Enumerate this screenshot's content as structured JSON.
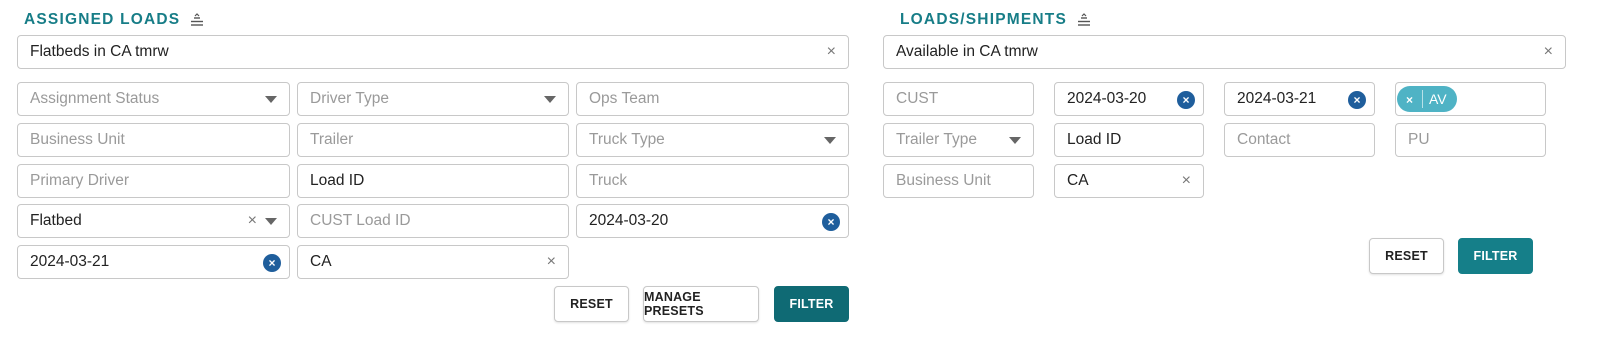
{
  "assigned_loads": {
    "title": "ASSIGNED LOADS",
    "search_value": "Flatbeds in CA tmrw",
    "fields": {
      "assignment_status": "Assignment Status",
      "driver_type": "Driver Type",
      "ops_team": "Ops Team",
      "business_unit": "Business Unit",
      "trailer": "Trailer",
      "truck_type": "Truck Type",
      "primary_driver": "Primary Driver",
      "load_id": "Load ID",
      "truck": "Truck",
      "trailer_type_value": "Flatbed",
      "cust_load_id": "CUST Load ID",
      "date_start": "2024-03-20",
      "date_end": "2024-03-21",
      "state_value": "CA"
    },
    "buttons": {
      "reset": "RESET",
      "manage_presets": "MANAGE PRESETS",
      "filter": "FILTER"
    }
  },
  "loads_shipments": {
    "title": "LOADS/SHIPMENTS",
    "search_value": "Available in CA tmrw",
    "fields": {
      "cust": "CUST",
      "date_start": "2024-03-20",
      "date_end": "2024-03-21",
      "status_chip": "AV",
      "trailer_type": "Trailer Type",
      "load_id": "Load ID",
      "contact": "Contact",
      "pu": "PU",
      "business_unit": "Business Unit",
      "state_value": "CA"
    },
    "buttons": {
      "reset": "RESET",
      "filter": "FILTER"
    }
  },
  "icons": {
    "clear": "×",
    "circle_clear": "×",
    "collapse": "collapse-icon"
  },
  "colors": {
    "accent": "#177d87",
    "filter_dark": "#0f6a74",
    "filter": "#157f89",
    "clear_circle": "#1f5e9c",
    "chip": "#4fb3c5"
  }
}
